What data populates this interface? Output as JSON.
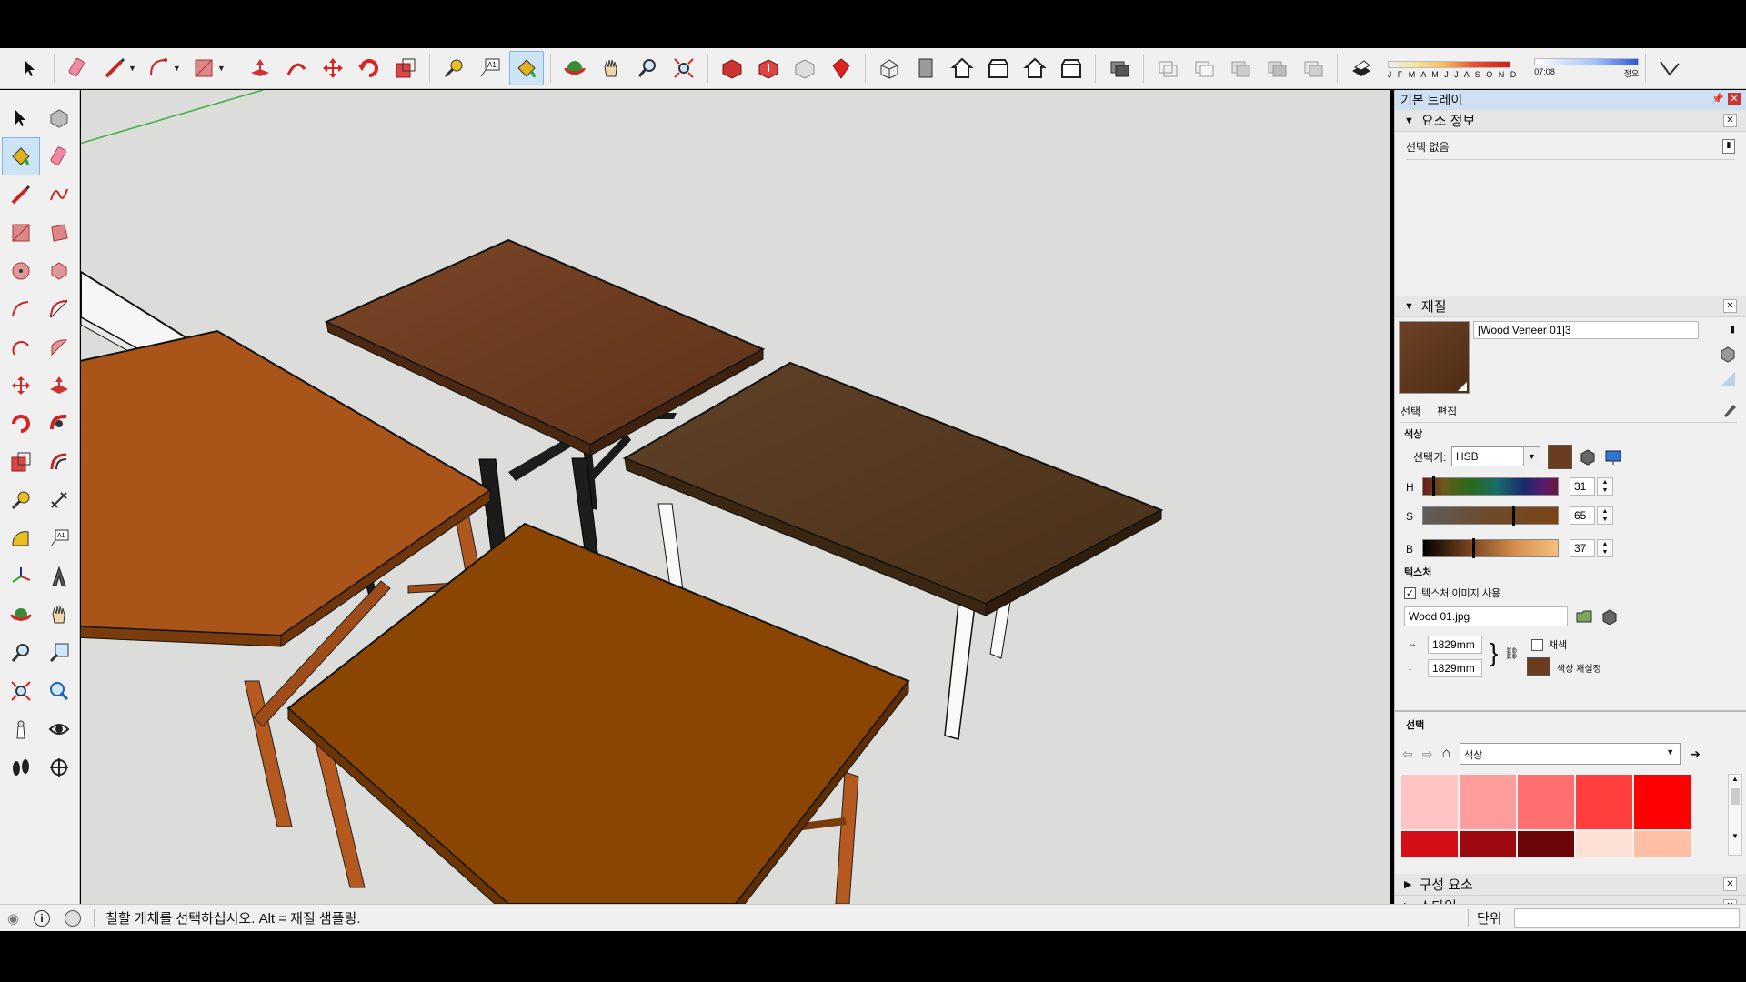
{
  "toolbar": {
    "shadow_months": "J F M A M J J A S O N D",
    "shadow_time_start": "07:08",
    "shadow_time_end": "정오"
  },
  "tray": {
    "title": "기본 트레이",
    "entity_info": {
      "header": "요소 정보",
      "selection_text": "선택 없음"
    },
    "materials": {
      "header": "재질",
      "material_name": "[Wood Veneer 01]3",
      "tab_select": "선택",
      "tab_edit": "편집",
      "color_section": "색상",
      "picker_label": "선택기:",
      "picker_value": "HSB",
      "h_label": "H",
      "h_value": "31",
      "s_label": "S",
      "s_value": "65",
      "b_label": "B",
      "b_value": "37",
      "swatch_color": "#6a3d1e",
      "texture_section": "텍스처",
      "use_texture_label": "텍스처 이미지 사용",
      "use_texture_checked": true,
      "texture_file": "Wood 01.jpg",
      "width_value": "1829mm",
      "height_value": "1829mm",
      "colorize_label": "채색",
      "reset_color_label": "색상 재설정"
    },
    "select": {
      "label": "선택",
      "collection": "색상",
      "swatches": [
        "#ffc5c5",
        "#ff9c9c",
        "#ff6f6f",
        "#ff3e3e",
        "#ff0000",
        "#d40f17",
        "#9c0a10",
        "#6b0508",
        "#ffe0d4",
        "#ffbfa4"
      ]
    },
    "components_header": "구성 요소",
    "styles_header": "스타일"
  },
  "status": {
    "message": "칠할 개체를 선택하십시오. Alt = 재질 샘플링.",
    "units_label": "단위",
    "measurement_value": ""
  }
}
